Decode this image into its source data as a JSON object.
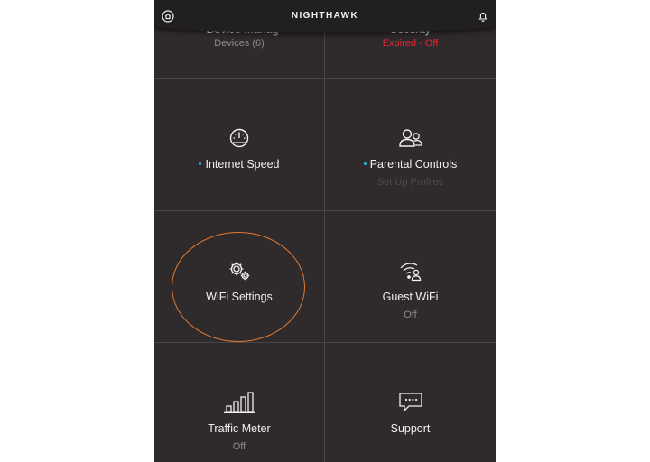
{
  "header": {
    "logo": "NIGHTHAWK",
    "home_icon": "home-icon",
    "bell_icon": "bell-icon"
  },
  "tiles": [
    {
      "label": "Device Manag",
      "sub": "Devices (6)",
      "icon": "devices-icon",
      "new_dot": true
    },
    {
      "label": "Security",
      "sub": "Expired - Off",
      "icon": "shield-icon",
      "sub_color": "#e0282e"
    },
    {
      "label": "Internet Speed",
      "icon": "speedometer-icon",
      "new_dot": true
    },
    {
      "label": "Parental Controls",
      "sub": "Set Up Profiles",
      "icon": "users-icon",
      "new_dot": true
    },
    {
      "label": "WiFi Settings",
      "icon": "gears-icon",
      "highlighted": true
    },
    {
      "label": "Guest WiFi",
      "sub": "Off",
      "icon": "guest-wifi-icon"
    },
    {
      "label": "Traffic Meter",
      "sub": "Off",
      "icon": "bar-chart-icon"
    },
    {
      "label": "Support",
      "icon": "chat-bubble-icon"
    }
  ],
  "colors": {
    "background": "#2f2a2c",
    "header": "#221f20",
    "accent_dot": "#29b6e8",
    "alert": "#e0282e",
    "highlight_ring": "#e07b33"
  }
}
